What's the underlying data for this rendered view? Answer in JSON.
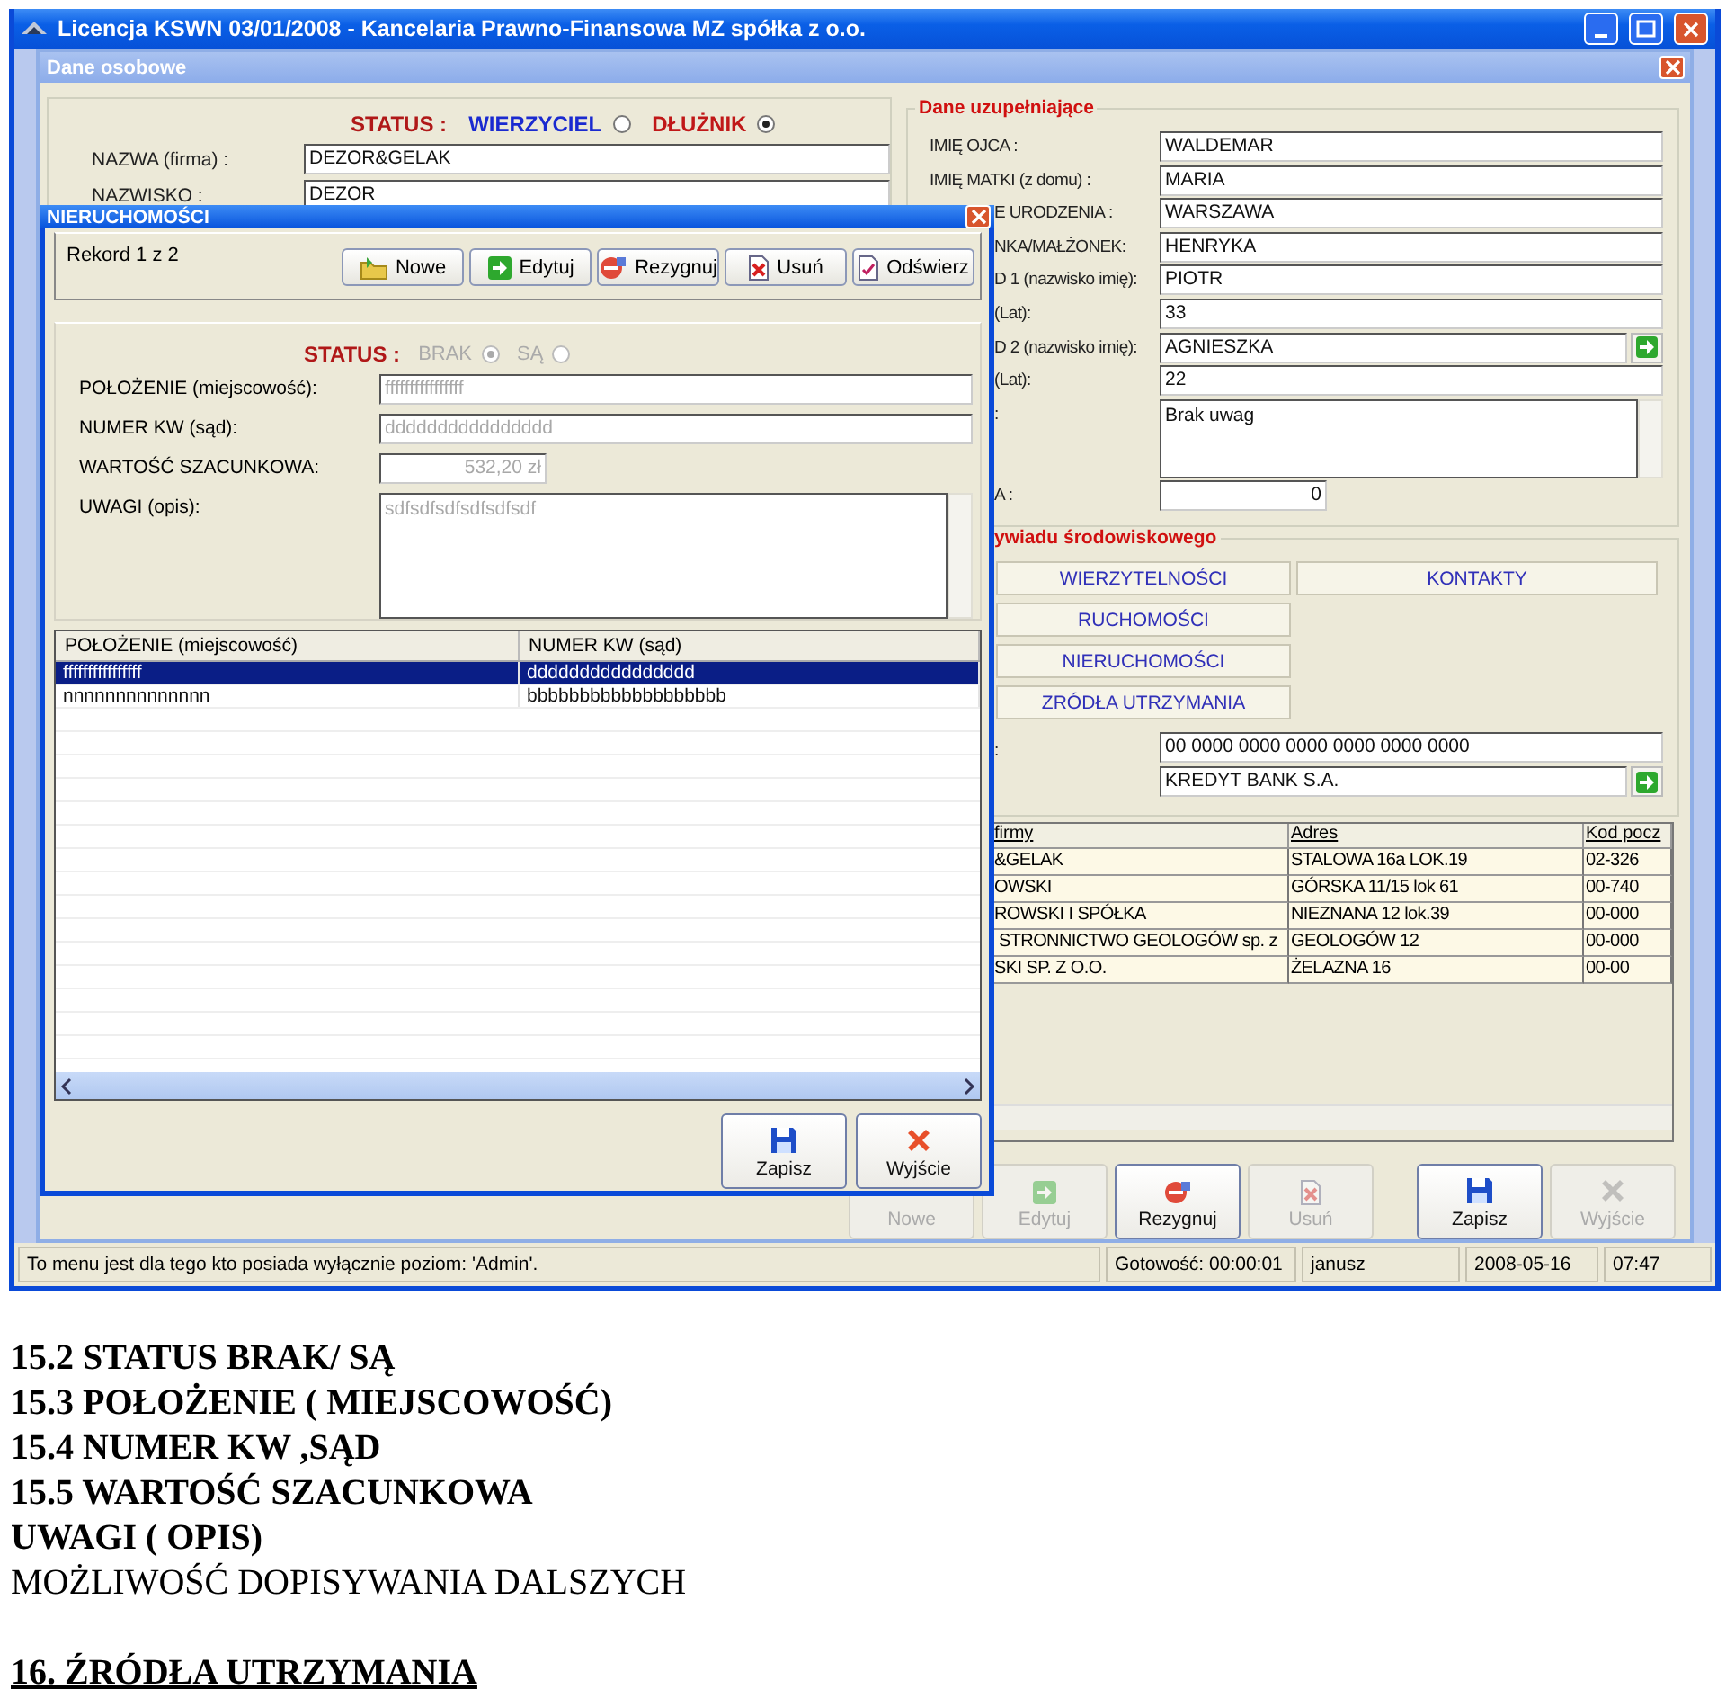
{
  "app": {
    "title": "Licencja KSWN 03/01/2008 - Kancelaria Prawno-Finansowa MZ spółka z o.o."
  },
  "child_window": {
    "title": "Dane osobowe"
  },
  "status_group": {
    "label": "STATUS :",
    "options": [
      {
        "label": "WIERZYCIEL",
        "selected": false
      },
      {
        "label": "DŁUŻNIK",
        "selected": true
      }
    ]
  },
  "main_fields": [
    {
      "label": "NAZWA (firma) :",
      "value": "DEZOR&GELAK"
    },
    {
      "label": "NAZWISKO :",
      "value": "DEZOR"
    }
  ],
  "dane_uzupelniajace": {
    "title": "Dane uzupełniające",
    "rows": [
      {
        "label": "IMIĘ OJCA :",
        "value": "WALDEMAR",
        "kind": "field"
      },
      {
        "label": "IMIĘ MATKI (z domu) :",
        "value": "MARIA",
        "kind": "field"
      },
      {
        "label": "E URODZENIA :",
        "value": "WARSZAWA",
        "kind": "field"
      },
      {
        "label": "NKA/MAŁŻONEK:",
        "value": "HENRYKA",
        "kind": "field"
      },
      {
        "label": "D 1 (nazwisko imię):",
        "value": "PIOTR",
        "kind": "field"
      },
      {
        "label": "(Lat):",
        "value": "33",
        "kind": "field"
      },
      {
        "label": "D 2 (nazwisko imię):",
        "value": "AGNIESZKA",
        "kind": "lookup"
      },
      {
        "label": "(Lat):",
        "value": "22",
        "kind": "field"
      },
      {
        "label": ":",
        "value": "Brak uwag",
        "kind": "memo"
      },
      {
        "label": "A :",
        "value": "0",
        "kind": "number"
      }
    ]
  },
  "wywiad": {
    "title": "ywiadu środowiskowego",
    "buttons": [
      [
        "WIERZYTELNOŚCI",
        "KONTAKTY"
      ],
      [
        "RUCHOMOŚCI"
      ],
      [
        "NIERUCHOMOŚCI"
      ],
      [
        "ZRÓDŁA UTRZYMANIA"
      ]
    ]
  },
  "account": {
    "label": ":",
    "number": "00 0000 0000 0000 0000 0000 0000",
    "bank": "KREDYT BANK S.A."
  },
  "firms_table": {
    "columns": [
      "firmy",
      "Adres",
      "Kod pocz"
    ],
    "rows": [
      [
        "&GELAK",
        "STALOWA 16a LOK.19",
        "02-326"
      ],
      [
        "OWSKI",
        "GÓRSKA 11/15 lok 61",
        "00-740"
      ],
      [
        "ROWSKI I SPÓŁKA",
        "NIEZNANA 12 lok.39",
        "00-000"
      ],
      [
        " STRONNICTWO GEOLOGÓW sp. z",
        "GEOLOGÓW 12",
        "00-000"
      ],
      [
        "SKI SP. Z O.O.",
        "ŻELAZNA 16",
        "00-00"
      ]
    ]
  },
  "bottom_buttons": [
    {
      "label": "Nowe",
      "disabled": true
    },
    {
      "label": "Edytuj",
      "disabled": true,
      "kind": "edit"
    },
    {
      "label": "Rezygnuj",
      "disabled": false,
      "kind": "cancel"
    },
    {
      "label": "Usuń",
      "disabled": true,
      "kind": "delete"
    },
    {
      "label": "Zapisz",
      "disabled": false,
      "kind": "save"
    },
    {
      "label": "Wyjście",
      "disabled": true,
      "kind": "exit"
    }
  ],
  "status_bar": {
    "message": "To menu jest dla tego kto posiada wyłącznie poziom: 'Admin'.",
    "ready": "Gotowość: 00:00:01",
    "user": "janusz",
    "date": "2008-05-16",
    "time": "07:47"
  },
  "dialog": {
    "title": "NIERUCHOMOŚCI",
    "record": "Rekord 1 z 2",
    "toolbar": [
      {
        "label": "Nowe",
        "kind": "new"
      },
      {
        "label": "Edytuj",
        "kind": "edit"
      },
      {
        "label": "Rezygnuj",
        "kind": "cancel"
      },
      {
        "label": "Usuń",
        "kind": "delete"
      },
      {
        "label": "Odświerz",
        "kind": "refresh"
      }
    ],
    "status": {
      "label": "STATUS :",
      "disabled": true,
      "options": [
        {
          "label": "BRAK",
          "selected": true
        },
        {
          "label": "SĄ",
          "selected": false
        }
      ]
    },
    "fields": [
      {
        "label": "POŁOŻENIE (miejscowość):",
        "value": "ffffffffffffffff",
        "kind": "field"
      },
      {
        "label": "NUMER KW (sąd):",
        "value": "dddddddddddddddd",
        "kind": "field"
      },
      {
        "label": "WARTOŚĆ SZACUNKOWA:",
        "value": "532,20 zł",
        "kind": "money"
      },
      {
        "label": "UWAGI (opis):",
        "value": "sdfsdfsdfsdfsdfsdf",
        "kind": "memo"
      }
    ],
    "table": {
      "columns": [
        "POŁOŻENIE (miejscowość)",
        "NUMER KW (sąd)"
      ],
      "rows": [
        {
          "cells": [
            "ffffffffffffffff",
            "dddddddddddddddd"
          ],
          "selected": true
        },
        {
          "cells": [
            "nnnnnnnnnnnnnn",
            "bbbbbbbbbbbbbbbbbbb"
          ],
          "selected": false
        }
      ]
    },
    "buttons": [
      {
        "label": "Zapisz",
        "kind": "save"
      },
      {
        "label": "Wyjście",
        "kind": "exit"
      }
    ]
  },
  "document": {
    "lines": [
      {
        "text": "15.2 STATUS BRAK/ SĄ",
        "bold": true
      },
      {
        "text": "15.3 POŁOŻENIE ( MIEJSCOWOŚĆ)",
        "bold": true
      },
      {
        "text": "15.4 NUMER KW ,SĄD",
        "bold": true
      },
      {
        "text": "15.5 WARTOŚĆ SZACUNKOWA",
        "bold": true
      },
      {
        "text": "UWAGI ( OPIS)",
        "bold": true
      },
      {
        "text": "MOŻLIWOŚĆ DOPISYWANIA DALSZYCH",
        "bold": false
      }
    ],
    "heading": "16. ŹRÓDŁA UTRZYMANIA"
  }
}
